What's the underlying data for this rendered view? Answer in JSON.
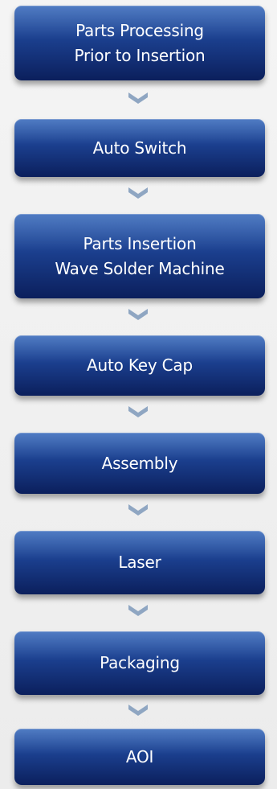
{
  "steps": [
    {
      "lines": [
        "Parts Processing",
        "Prior to Insertion"
      ]
    },
    {
      "lines": [
        "Auto Switch"
      ]
    },
    {
      "lines": [
        "Parts Insertion",
        "Wave Solder Machine"
      ]
    },
    {
      "lines": [
        "Auto Key Cap"
      ]
    },
    {
      "lines": [
        "Assembly"
      ]
    },
    {
      "lines": [
        "Laser"
      ]
    },
    {
      "lines": [
        "Packaging"
      ]
    },
    {
      "lines": [
        "AOI"
      ]
    }
  ],
  "colors": {
    "box_top": "#2f63b8",
    "box_bottom": "#0b1f5c",
    "arrow": "#8fa6c2",
    "text": "#ffffff"
  }
}
